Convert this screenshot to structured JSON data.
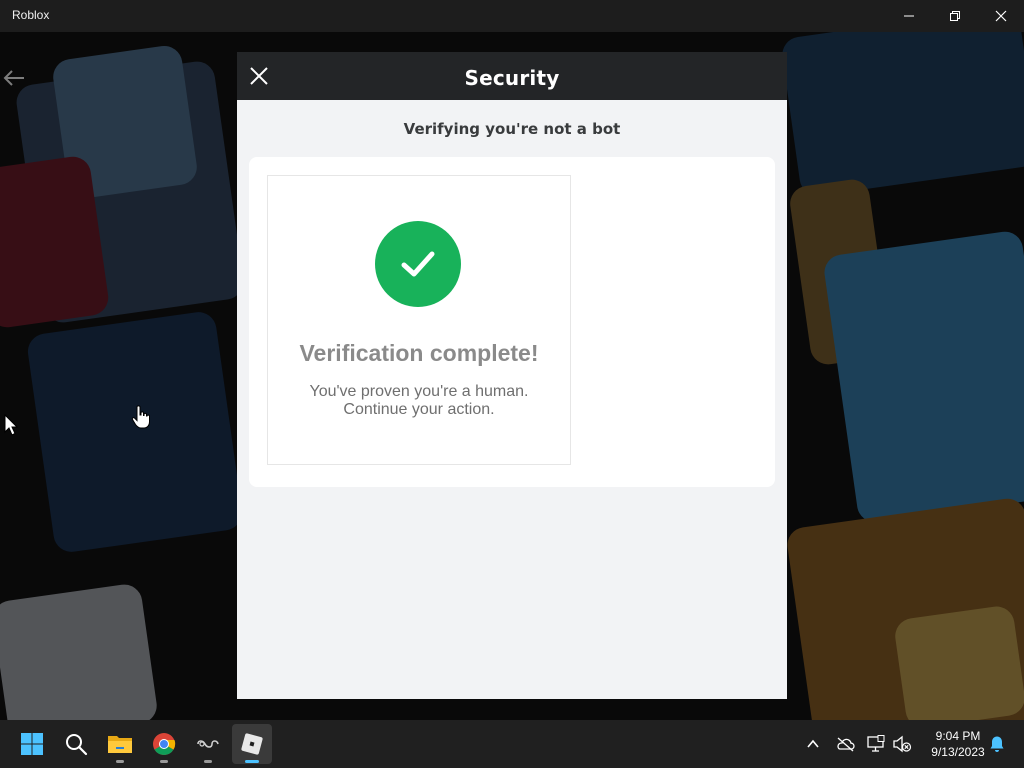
{
  "window": {
    "title": "Roblox",
    "controls": [
      "minimize-icon",
      "restore-icon",
      "close-icon"
    ]
  },
  "background": {
    "back_icon": "arrow-left-icon"
  },
  "modal": {
    "title": "Security",
    "close_icon": "close-icon",
    "subtitle": "Verifying you're not a bot",
    "card": {
      "status_icon": "checkmark-icon",
      "status_color": "#18b25a",
      "heading": "Verification complete!",
      "message_line1": "You've proven you're a human.",
      "message_line2": "Continue your action."
    }
  },
  "taskbar": {
    "apps": [
      {
        "name": "Start",
        "icon": "windows-start-icon"
      },
      {
        "name": "Search",
        "icon": "search-icon"
      },
      {
        "name": "File Explorer",
        "icon": "folder-icon"
      },
      {
        "name": "Google Chrome",
        "icon": "chrome-icon"
      },
      {
        "name": "App",
        "icon": "app-logo-icon"
      },
      {
        "name": "Roblox",
        "icon": "roblox-icon",
        "active": true
      }
    ],
    "tray_icons": [
      "chevron-up-icon",
      "onedrive-icon",
      "network-icon",
      "volume-muted-icon"
    ],
    "clock": {
      "time": "9:04 PM",
      "date": "9/13/2023"
    },
    "notification_icon": "bell-icon"
  }
}
